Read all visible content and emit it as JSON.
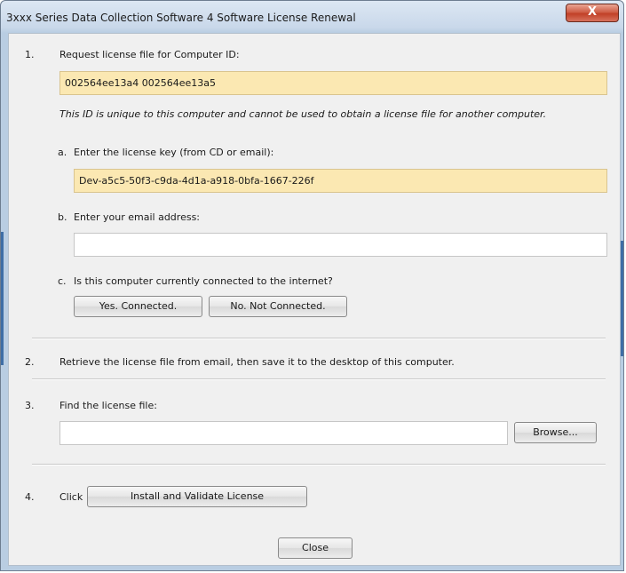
{
  "window": {
    "title": "3xxx Series Data Collection Software 4 Software License Renewal",
    "close_glyph": "X"
  },
  "step1": {
    "number": "1.",
    "label": "Request license file for Computer ID:",
    "computer_id": "002564ee13a4 002564ee13a5",
    "note": "This ID is unique to this computer and cannot be used to obtain a license file for another computer.",
    "a": {
      "letter": "a.",
      "label": "Enter the license key (from CD or email):",
      "value": "Dev-a5c5-50f3-c9da-4d1a-a918-0bfa-1667-226f"
    },
    "b": {
      "letter": "b.",
      "label": "Enter your email address:",
      "value": ""
    },
    "c": {
      "letter": "c.",
      "label": "Is this computer currently connected to the internet?",
      "yes_label": "Yes.  Connected.",
      "no_label": "No.  Not Connected."
    }
  },
  "step2": {
    "number": "2.",
    "label": "Retrieve the license file from email, then save it to the desktop of this computer."
  },
  "step3": {
    "number": "3.",
    "label": "Find the license file:",
    "value": "",
    "browse_label": "Browse..."
  },
  "step4": {
    "number": "4.",
    "label": "Click",
    "install_label": "Install and Validate License"
  },
  "footer": {
    "close_label": "Close"
  },
  "colors": {
    "highlight_field": "#fbe8b2",
    "close_button": "#c14027"
  }
}
